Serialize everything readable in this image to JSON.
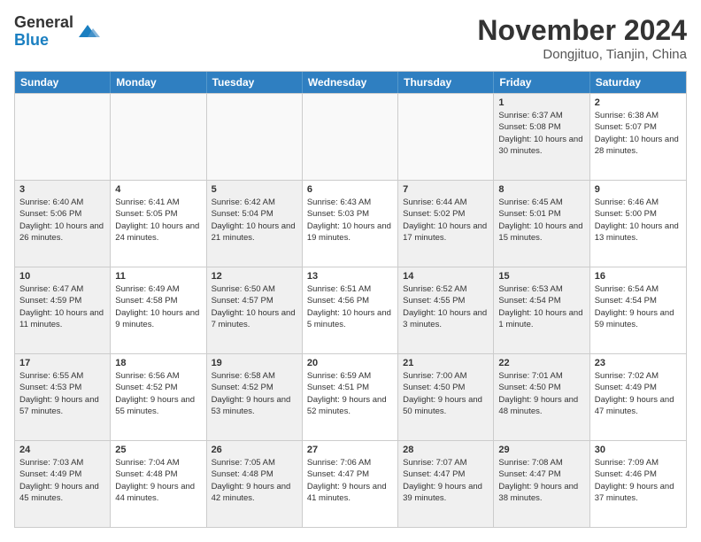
{
  "header": {
    "logo_general": "General",
    "logo_blue": "Blue",
    "month_title": "November 2024",
    "subtitle": "Dongjituo, Tianjin, China"
  },
  "days_of_week": [
    "Sunday",
    "Monday",
    "Tuesday",
    "Wednesday",
    "Thursday",
    "Friday",
    "Saturday"
  ],
  "weeks": [
    [
      {
        "day": "",
        "info": "",
        "empty": true
      },
      {
        "day": "",
        "info": "",
        "empty": true
      },
      {
        "day": "",
        "info": "",
        "empty": true
      },
      {
        "day": "",
        "info": "",
        "empty": true
      },
      {
        "day": "",
        "info": "",
        "empty": true
      },
      {
        "day": "1",
        "info": "Sunrise: 6:37 AM\nSunset: 5:08 PM\nDaylight: 10 hours and 30 minutes.",
        "shaded": true
      },
      {
        "day": "2",
        "info": "Sunrise: 6:38 AM\nSunset: 5:07 PM\nDaylight: 10 hours and 28 minutes."
      }
    ],
    [
      {
        "day": "3",
        "info": "Sunrise: 6:40 AM\nSunset: 5:06 PM\nDaylight: 10 hours and 26 minutes.",
        "shaded": true
      },
      {
        "day": "4",
        "info": "Sunrise: 6:41 AM\nSunset: 5:05 PM\nDaylight: 10 hours and 24 minutes."
      },
      {
        "day": "5",
        "info": "Sunrise: 6:42 AM\nSunset: 5:04 PM\nDaylight: 10 hours and 21 minutes.",
        "shaded": true
      },
      {
        "day": "6",
        "info": "Sunrise: 6:43 AM\nSunset: 5:03 PM\nDaylight: 10 hours and 19 minutes."
      },
      {
        "day": "7",
        "info": "Sunrise: 6:44 AM\nSunset: 5:02 PM\nDaylight: 10 hours and 17 minutes.",
        "shaded": true
      },
      {
        "day": "8",
        "info": "Sunrise: 6:45 AM\nSunset: 5:01 PM\nDaylight: 10 hours and 15 minutes.",
        "shaded": true
      },
      {
        "day": "9",
        "info": "Sunrise: 6:46 AM\nSunset: 5:00 PM\nDaylight: 10 hours and 13 minutes."
      }
    ],
    [
      {
        "day": "10",
        "info": "Sunrise: 6:47 AM\nSunset: 4:59 PM\nDaylight: 10 hours and 11 minutes.",
        "shaded": true
      },
      {
        "day": "11",
        "info": "Sunrise: 6:49 AM\nSunset: 4:58 PM\nDaylight: 10 hours and 9 minutes."
      },
      {
        "day": "12",
        "info": "Sunrise: 6:50 AM\nSunset: 4:57 PM\nDaylight: 10 hours and 7 minutes.",
        "shaded": true
      },
      {
        "day": "13",
        "info": "Sunrise: 6:51 AM\nSunset: 4:56 PM\nDaylight: 10 hours and 5 minutes."
      },
      {
        "day": "14",
        "info": "Sunrise: 6:52 AM\nSunset: 4:55 PM\nDaylight: 10 hours and 3 minutes.",
        "shaded": true
      },
      {
        "day": "15",
        "info": "Sunrise: 6:53 AM\nSunset: 4:54 PM\nDaylight: 10 hours and 1 minute.",
        "shaded": true
      },
      {
        "day": "16",
        "info": "Sunrise: 6:54 AM\nSunset: 4:54 PM\nDaylight: 9 hours and 59 minutes."
      }
    ],
    [
      {
        "day": "17",
        "info": "Sunrise: 6:55 AM\nSunset: 4:53 PM\nDaylight: 9 hours and 57 minutes.",
        "shaded": true
      },
      {
        "day": "18",
        "info": "Sunrise: 6:56 AM\nSunset: 4:52 PM\nDaylight: 9 hours and 55 minutes."
      },
      {
        "day": "19",
        "info": "Sunrise: 6:58 AM\nSunset: 4:52 PM\nDaylight: 9 hours and 53 minutes.",
        "shaded": true
      },
      {
        "day": "20",
        "info": "Sunrise: 6:59 AM\nSunset: 4:51 PM\nDaylight: 9 hours and 52 minutes."
      },
      {
        "day": "21",
        "info": "Sunrise: 7:00 AM\nSunset: 4:50 PM\nDaylight: 9 hours and 50 minutes.",
        "shaded": true
      },
      {
        "day": "22",
        "info": "Sunrise: 7:01 AM\nSunset: 4:50 PM\nDaylight: 9 hours and 48 minutes.",
        "shaded": true
      },
      {
        "day": "23",
        "info": "Sunrise: 7:02 AM\nSunset: 4:49 PM\nDaylight: 9 hours and 47 minutes."
      }
    ],
    [
      {
        "day": "24",
        "info": "Sunrise: 7:03 AM\nSunset: 4:49 PM\nDaylight: 9 hours and 45 minutes.",
        "shaded": true
      },
      {
        "day": "25",
        "info": "Sunrise: 7:04 AM\nSunset: 4:48 PM\nDaylight: 9 hours and 44 minutes."
      },
      {
        "day": "26",
        "info": "Sunrise: 7:05 AM\nSunset: 4:48 PM\nDaylight: 9 hours and 42 minutes.",
        "shaded": true
      },
      {
        "day": "27",
        "info": "Sunrise: 7:06 AM\nSunset: 4:47 PM\nDaylight: 9 hours and 41 minutes."
      },
      {
        "day": "28",
        "info": "Sunrise: 7:07 AM\nSunset: 4:47 PM\nDaylight: 9 hours and 39 minutes.",
        "shaded": true
      },
      {
        "day": "29",
        "info": "Sunrise: 7:08 AM\nSunset: 4:47 PM\nDaylight: 9 hours and 38 minutes.",
        "shaded": true
      },
      {
        "day": "30",
        "info": "Sunrise: 7:09 AM\nSunset: 4:46 PM\nDaylight: 9 hours and 37 minutes."
      }
    ]
  ]
}
